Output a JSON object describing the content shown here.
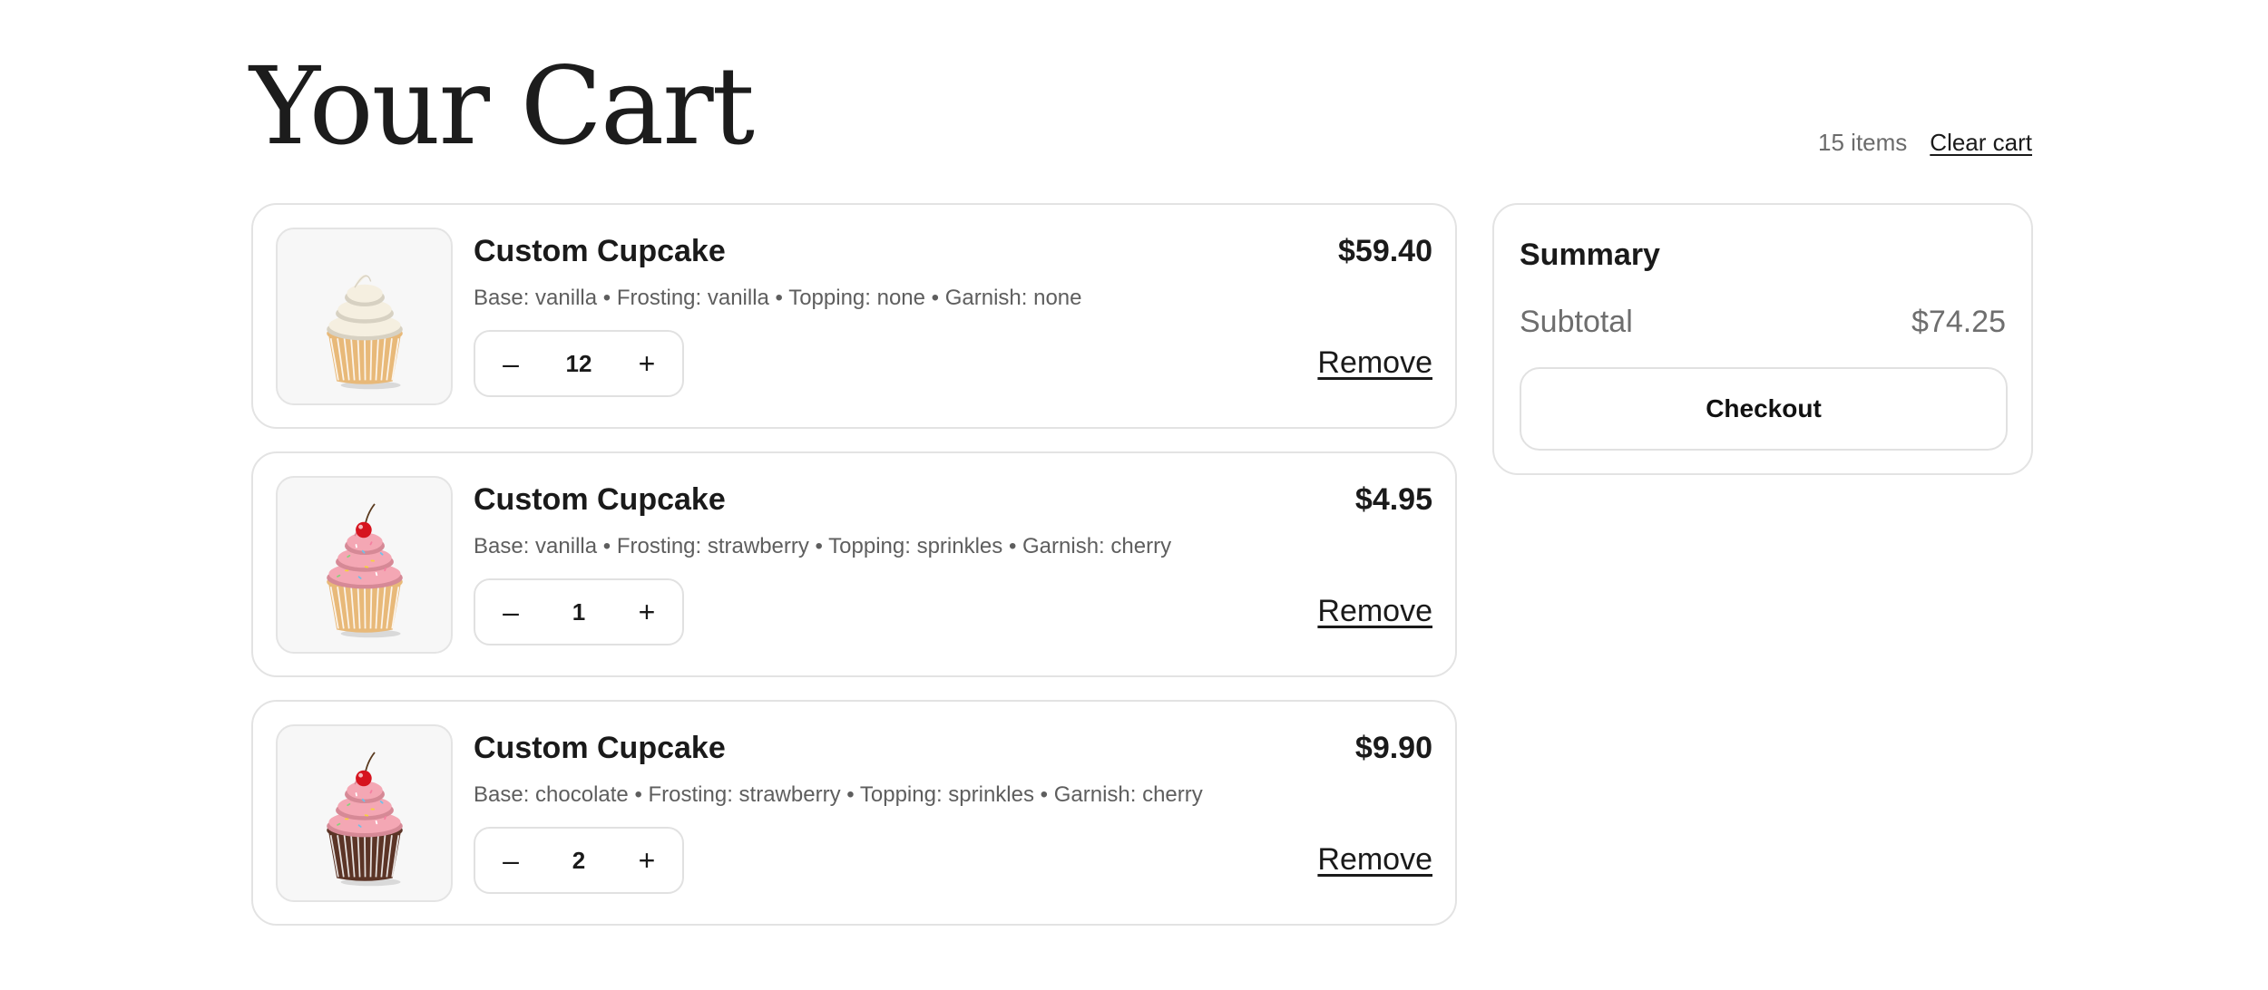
{
  "header": {
    "title": "Your Cart",
    "item_count": "15 items",
    "clear_cart_label": "Clear cart"
  },
  "cart": {
    "items": [
      {
        "name": "Custom Cupcake",
        "price": "$59.40",
        "options": "Base: vanilla • Frosting: vanilla • Topping: none • Garnish: none",
        "quantity": "12",
        "decrement_label": "–",
        "increment_label": "+",
        "remove_label": "Remove",
        "image": {
          "icon": "cupcake-vanilla-icon",
          "frosting_color": "#f5efe0",
          "base_color": "#e8b979",
          "garnish": "none",
          "sprinkles": false
        }
      },
      {
        "name": "Custom Cupcake",
        "price": "$4.95",
        "options": "Base: vanilla • Frosting: strawberry • Topping: sprinkles • Garnish: cherry",
        "quantity": "1",
        "decrement_label": "–",
        "increment_label": "+",
        "remove_label": "Remove",
        "image": {
          "icon": "cupcake-strawberry-cherry-icon",
          "frosting_color": "#f4a7b4",
          "base_color": "#e8b979",
          "garnish": "cherry",
          "sprinkles": true
        }
      },
      {
        "name": "Custom Cupcake",
        "price": "$9.90",
        "options": "Base: chocolate • Frosting: strawberry • Topping: sprinkles • Garnish: cherry",
        "quantity": "2",
        "decrement_label": "–",
        "increment_label": "+",
        "remove_label": "Remove",
        "image": {
          "icon": "cupcake-chocolate-cherry-icon",
          "frosting_color": "#f4a7b4",
          "base_color": "#5b3426",
          "garnish": "cherry",
          "sprinkles": true
        }
      }
    ]
  },
  "summary": {
    "title": "Summary",
    "subtotal_label": "Subtotal",
    "subtotal_value": "$74.25",
    "checkout_label": "Checkout"
  },
  "colors": {
    "text": "#1a1a1a",
    "muted_text": "#6b6b6b",
    "border": "#e3e3e3",
    "cherry": "#d6141f"
  }
}
